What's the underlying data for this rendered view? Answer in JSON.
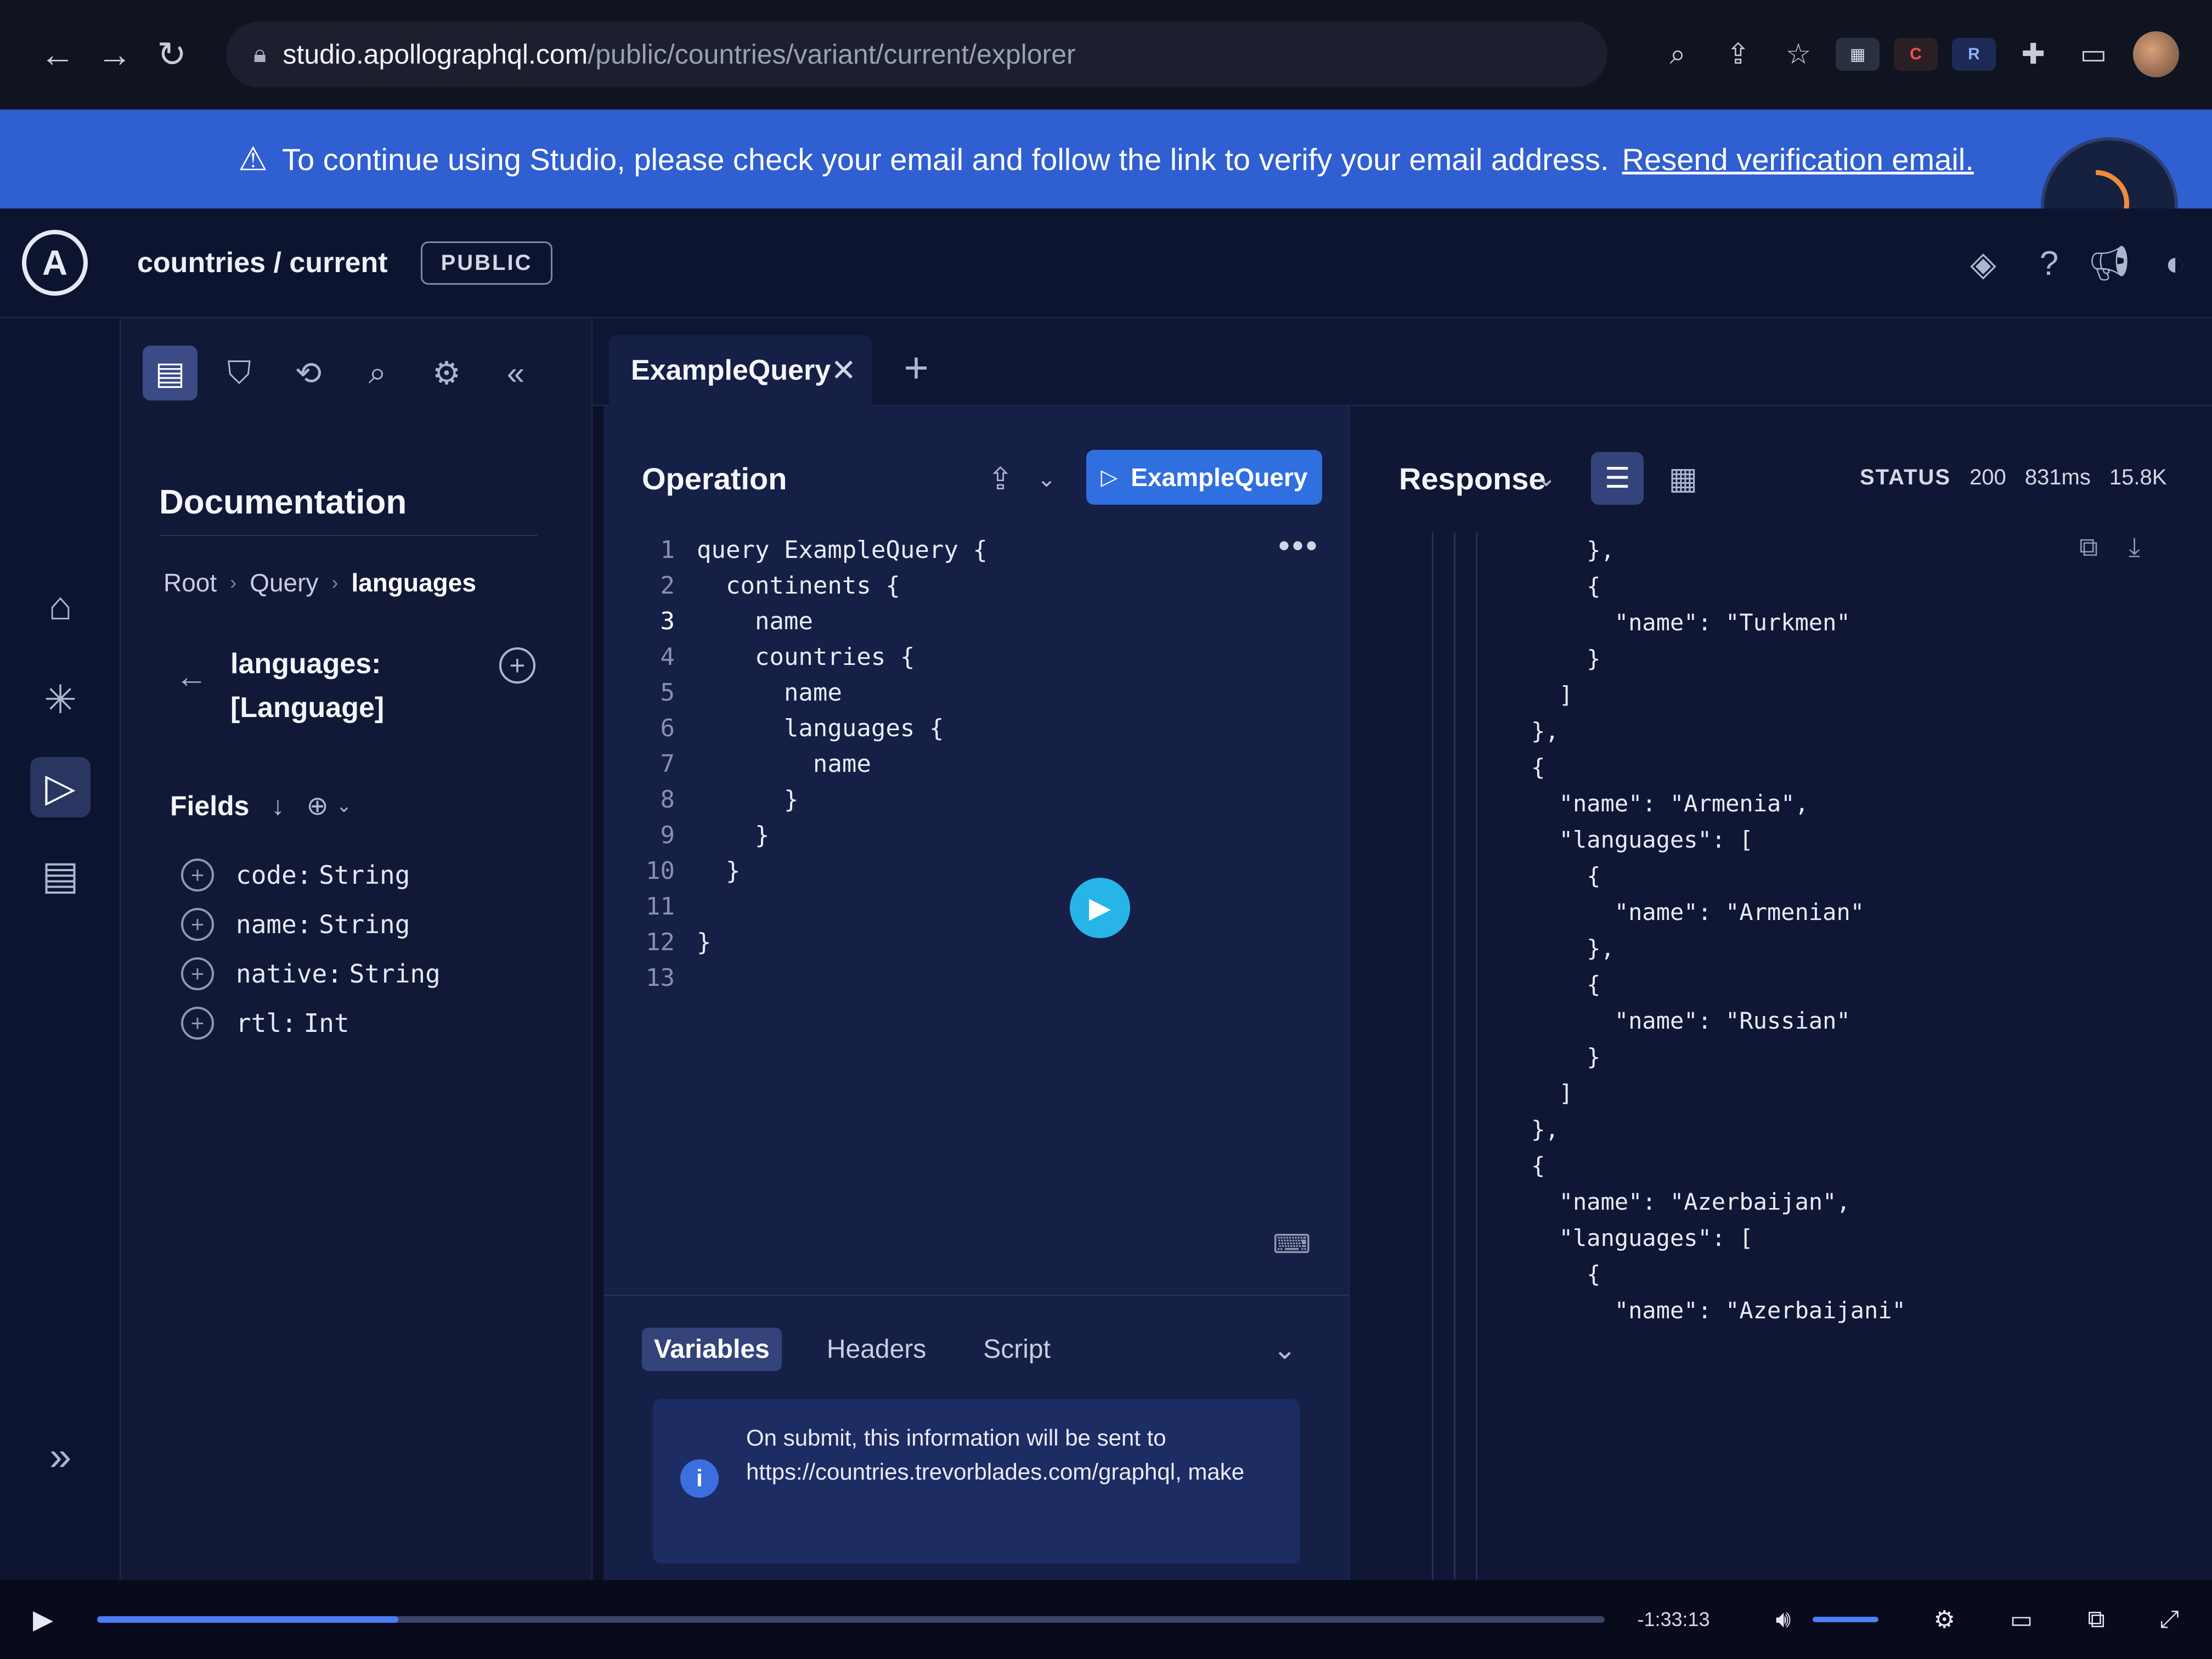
{
  "browser": {
    "url_host": "studio.apollographql.com",
    "url_path": "/public/countries/variant/current/explorer"
  },
  "banner": {
    "message": "To continue using Studio, please check your email and follow the link to verify your email address.",
    "link_label": "Resend verification email."
  },
  "header": {
    "graph_title": "countries / current",
    "badge": "PUBLIC"
  },
  "docs": {
    "title": "Documentation",
    "breadcrumb": [
      "Root",
      "Query",
      "languages"
    ],
    "field_name": "languages:",
    "field_type": "[Language]",
    "fields_label": "Fields",
    "fields": [
      {
        "name": "code:",
        "type": "String"
      },
      {
        "name": "name:",
        "type": "String"
      },
      {
        "name": "native:",
        "type": "String"
      },
      {
        "name": "rtl:",
        "type": "Int"
      }
    ]
  },
  "tabs": {
    "active_label": "ExampleQuery"
  },
  "operation": {
    "title": "Operation",
    "run_label": "ExampleQuery",
    "current_line": 3,
    "lines": [
      "query ExampleQuery {",
      "  continents {",
      "    name",
      "    countries {",
      "      name",
      "      languages {",
      "        name",
      "      }",
      "    }",
      "  }",
      "",
      "}",
      ""
    ],
    "lower_tabs": [
      "Variables",
      "Headers",
      "Script"
    ],
    "info_text": "On submit, this information will be sent to https://countries.trevorblades.com/graphql, make"
  },
  "response": {
    "title": "Response",
    "status_label": "STATUS",
    "status_code": "200",
    "time": "831ms",
    "size": "15.8K",
    "lines": [
      "        },",
      "        {",
      "          \"name\": \"Turkmen\"",
      "        }",
      "      ]",
      "    },",
      "    {",
      "      \"name\": \"Armenia\",",
      "      \"languages\": [",
      "        {",
      "          \"name\": \"Armenian\"",
      "        },",
      "        {",
      "          \"name\": \"Russian\"",
      "        }",
      "      ]",
      "    },",
      "    {",
      "      \"name\": \"Azerbaijan\",",
      "      \"languages\": [",
      "        {",
      "          \"name\": \"Azerbaijani\""
    ]
  },
  "video": {
    "time_remaining": "-1:33:13",
    "progress": 0.2
  }
}
